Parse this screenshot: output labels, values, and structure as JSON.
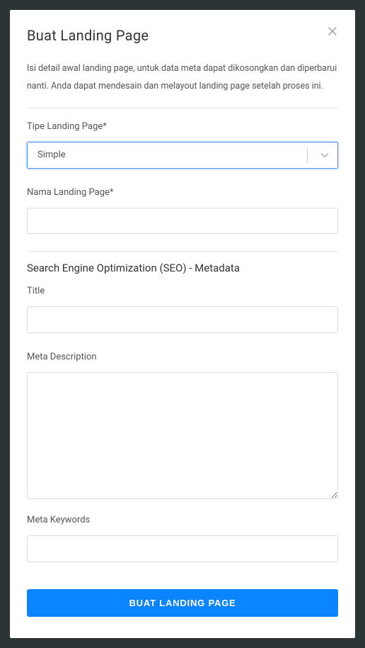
{
  "modal": {
    "title": "Buat Landing Page",
    "description": "Isi detail awal landing page, untuk data meta dapat dikosongkan dan diperbarui nanti. Anda dapat mendesain dan melayout landing page setelah proses ini.",
    "submit_label": "BUAT LANDING PAGE"
  },
  "form": {
    "type_label": "Tipe Landing Page*",
    "type_value": "Simple",
    "name_label": "Nama Landing Page*",
    "name_value": ""
  },
  "seo": {
    "heading": "Search Engine Optimization (SEO) - Metadata",
    "title_label": "Title",
    "title_value": "",
    "meta_desc_label": "Meta Description",
    "meta_desc_value": "",
    "meta_keywords_label": "Meta Keywords",
    "meta_keywords_value": ""
  }
}
